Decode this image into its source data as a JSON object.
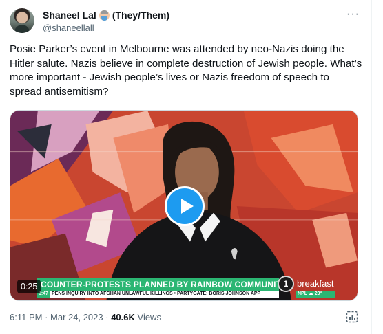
{
  "tweet": {
    "author": {
      "display_name": "Shaneel Lal",
      "pronouns": "(They/Them)",
      "handle": "@shaneellall",
      "avatar_icon": "avatar-photo",
      "emoji_icon": "person-emoji"
    },
    "more_label": "···",
    "text": "Posie Parker’s event in Melbourne was attended by neo-Nazis doing the Hitler salute. Nazis believe in complete destruction of Jewish people. What’s more important - Jewish people’s lives or Nazis freedom of speech to spread antisemitism?",
    "media": {
      "duration": "0:25",
      "play_icon": "play-icon",
      "banner_text": "COUNTER-PROTESTS PLANNED BY RAINBOW COMMUNITY",
      "ticker_time": "6:47",
      "ticker_text": "PENS INQUIRY INTO AFGHAN UNLAWFUL KILLINGS • PARTYGATE: BORIS JOHNSON APP",
      "channel_number": "1",
      "brand": "breakfast",
      "weather": "NPL ☁ 20°"
    },
    "meta": {
      "time": "6:11 PM",
      "separator": " · ",
      "date": "Mar 24, 2023",
      "views_count": "40.6K",
      "views_label": " Views"
    },
    "analytics_icon": "analytics-icon"
  },
  "colors": {
    "accent": "#1d9bf0",
    "text_primary": "#0f1419",
    "text_secondary": "#536471",
    "banner_green": "#2bb673"
  }
}
